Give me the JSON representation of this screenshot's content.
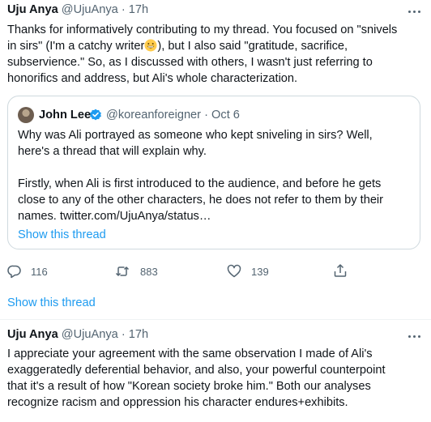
{
  "tweet1": {
    "author_name": "Uju Anya",
    "author_handle": "@UjuAnya",
    "time": "17h",
    "lines": [
      "Thanks for informatively contributing to my thread. You focused on \"snivels",
      "in sirs\" (I'm a catchy writer",
      "), but I also said \"gratitude, sacrifice,",
      "subservience.\" So, as I discussed with others, I wasn't just referring to",
      "honorifics and address, but Ali's whole characterization."
    ],
    "emoji_icon": "grinning-face-emoji",
    "quote": {
      "author_name": "John Lee",
      "author_handle": "@koreanforeigner",
      "time": "Oct 6",
      "verified_icon": "verified-badge-icon",
      "lines": [
        "Why was Ali portrayed as someone who kept sniveling in sirs? Well,",
        "here's a thread that will explain why.",
        "Firstly, when Ali is first introduced to the audience, and before he gets",
        "close to any of the other characters, he does not refer to them by their",
        "names. twitter.com/UjuAnya/status…"
      ],
      "show_thread": "Show this thread"
    },
    "actions": {
      "reply_count": "116",
      "retweet_count": "883",
      "like_count": "139",
      "icons": [
        "reply-icon",
        "retweet-icon",
        "like-icon",
        "share-icon"
      ]
    },
    "show_thread": "Show this thread"
  },
  "tweet2": {
    "author_name": "Uju Anya",
    "author_handle": "@UjuAnya",
    "time": "17h",
    "lines": [
      "I appreciate your agreement with the same observation I made of Ali's",
      "exaggeratedly deferential behavior, and also, your powerful counterpoint",
      "that it's a result of how \"Korean society broke him.\" Both our analyses",
      "recognize racism and oppression his character endures+exhibits."
    ]
  },
  "separator": "·",
  "colors": {
    "link": "#1d9bf0",
    "muted": "#536471",
    "border": "#cfd9de",
    "text": "#0f1419"
  }
}
